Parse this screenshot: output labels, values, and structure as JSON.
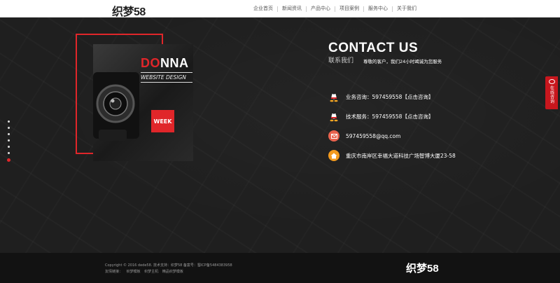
{
  "header": {
    "logo": "织梦58",
    "nav": [
      "企业首页",
      "新闻资讯",
      "产品中心",
      "项目案例",
      "服务中心",
      "关于我们"
    ]
  },
  "showcase": {
    "brand_prefix": "DO",
    "brand_rest": "NNA",
    "subtitle": "WEBSITE DESIGN",
    "badge": "WEEK"
  },
  "contact": {
    "title": "CONTACT US",
    "subtitle": "联系我们",
    "note": "尊敬的客户，我们24小时竭诚为您服务",
    "items": [
      {
        "icon": "qq-icon",
        "text": "业务咨询：597459558【点击咨询】",
        "color": "#ffffff"
      },
      {
        "icon": "qq-icon",
        "text": "技术服务：597459558【点击咨询】",
        "color": "#ffffff"
      },
      {
        "icon": "mail-icon",
        "text": "597459558@qq.com",
        "color": "#e9624d"
      },
      {
        "icon": "home-icon",
        "text": "重庆市南岸区幸福大道科技广场智博大厦23-58",
        "color": "#f39a1e"
      }
    ]
  },
  "side_button": {
    "label": "在线咨询"
  },
  "page_dots": {
    "count": 7,
    "active_index": 6
  },
  "footer": {
    "copyright": "Copyright © 2016  dede58.   技术支持：织梦58   备案号：蜀ICP备5484383958",
    "links": [
      "友情链接：",
      "织梦模板",
      "织梦主机",
      "精品织梦模板"
    ],
    "logo": "织梦58"
  },
  "colors": {
    "accent": "#e0262a",
    "dark": "#1f1f1f",
    "footer": "#121212"
  }
}
